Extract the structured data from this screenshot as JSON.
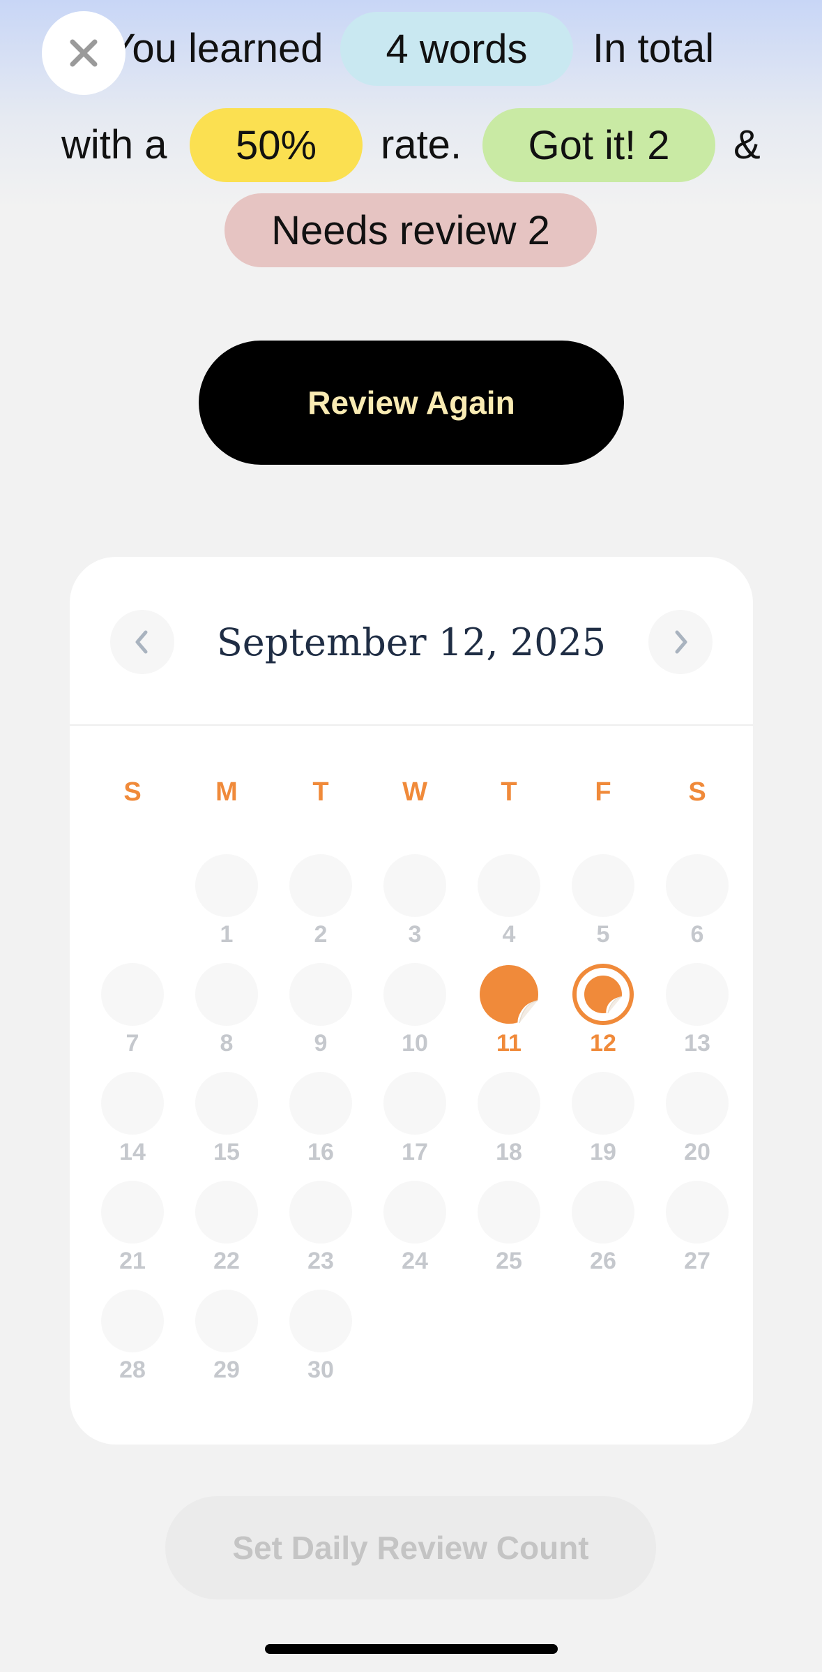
{
  "close": {
    "icon": "close-icon"
  },
  "summary": {
    "line1_text1": "You learned",
    "words_pill": "4 words",
    "line1_text2": "In total",
    "line2_text1": "with a",
    "rate_pill": "50%",
    "line2_text2": "rate.",
    "got_it_pill": "Got it! 2",
    "line2_text3": "&",
    "needs_review_pill": "Needs review 2"
  },
  "review_button": "Review Again",
  "calendar": {
    "title": "September 12, 2025",
    "prev_icon": "chevron-left-icon",
    "next_icon": "chevron-right-icon",
    "weekdays": [
      "S",
      "M",
      "T",
      "W",
      "T",
      "F",
      "S"
    ],
    "first_weekday_index": 1,
    "days_in_month": 30,
    "completed_day": 11,
    "selected_day": 12,
    "days": [
      "1",
      "2",
      "3",
      "4",
      "5",
      "6",
      "7",
      "8",
      "9",
      "10",
      "11",
      "12",
      "13",
      "14",
      "15",
      "16",
      "17",
      "18",
      "19",
      "20",
      "21",
      "22",
      "23",
      "24",
      "25",
      "26",
      "27",
      "28",
      "29",
      "30"
    ]
  },
  "daily_button": "Set Daily Review Count",
  "colors": {
    "accent": "#f08a3a",
    "pill_blue": "#c9e8f1",
    "pill_yellow": "#fbe051",
    "pill_green": "#c9eaa4",
    "pill_red": "#e6c4c2"
  }
}
